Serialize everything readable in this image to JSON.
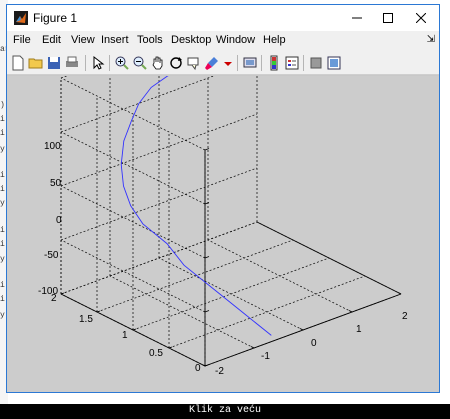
{
  "window": {
    "title": "Figure 1"
  },
  "menu": {
    "items": [
      "File",
      "Edit",
      "View",
      "Insert",
      "Tools",
      "Desktop",
      "Window",
      "Help"
    ],
    "overflow_glyph": "⇲"
  },
  "toolbar": {
    "buttons": [
      "new-figure-icon",
      "open-file-icon",
      "save-icon",
      "print-icon",
      "edit-plot-arrow-icon",
      "zoom-in-icon",
      "zoom-out-icon",
      "pan-hand-icon",
      "rotate-3d-icon",
      "data-cursor-icon",
      "brush-icon",
      "link-plot-icon",
      "insert-colorbar-icon",
      "insert-legend-icon",
      "hide-plot-tools-icon",
      "show-plot-tools-icon"
    ]
  },
  "plot": {
    "z_ticks": [
      "100",
      "50",
      "0",
      "-50",
      "-100"
    ],
    "y_ticks": [
      "2",
      "1.5",
      "1",
      "0.5",
      "0"
    ],
    "x_ticks": [
      "-2",
      "-1",
      "0",
      "1",
      "2"
    ],
    "line_color": "#3333ff"
  },
  "chart_data": {
    "type": "line",
    "title": "",
    "xlabel": "",
    "ylabel": "",
    "zlabel": "",
    "xlim": [
      -2,
      2
    ],
    "ylim": [
      0,
      2
    ],
    "zlim": [
      -100,
      100
    ],
    "grid": true,
    "series": [
      {
        "x": [
          -0.5,
          -0.8,
          -1.1,
          -1.4,
          -1.6,
          -1.8,
          -1.9,
          -1.9,
          -1.8,
          -1.6,
          -1.3,
          -1.0,
          -0.6,
          -0.2,
          0.2,
          0.6,
          1.0,
          1.4,
          1.8
        ],
        "y": [
          0.1,
          0.3,
          0.5,
          0.7,
          0.8,
          1.0,
          1.1,
          1.2,
          1.3,
          1.4,
          1.5,
          1.6,
          1.7,
          1.75,
          1.8,
          1.85,
          1.9,
          1.95,
          2.0
        ],
        "z": [
          -100,
          -80,
          -60,
          -40,
          -20,
          -5,
          10,
          25,
          40,
          55,
          65,
          73,
          78,
          80,
          79,
          77,
          74,
          70,
          65
        ]
      }
    ]
  },
  "caption": {
    "text": "Klik za veću"
  }
}
